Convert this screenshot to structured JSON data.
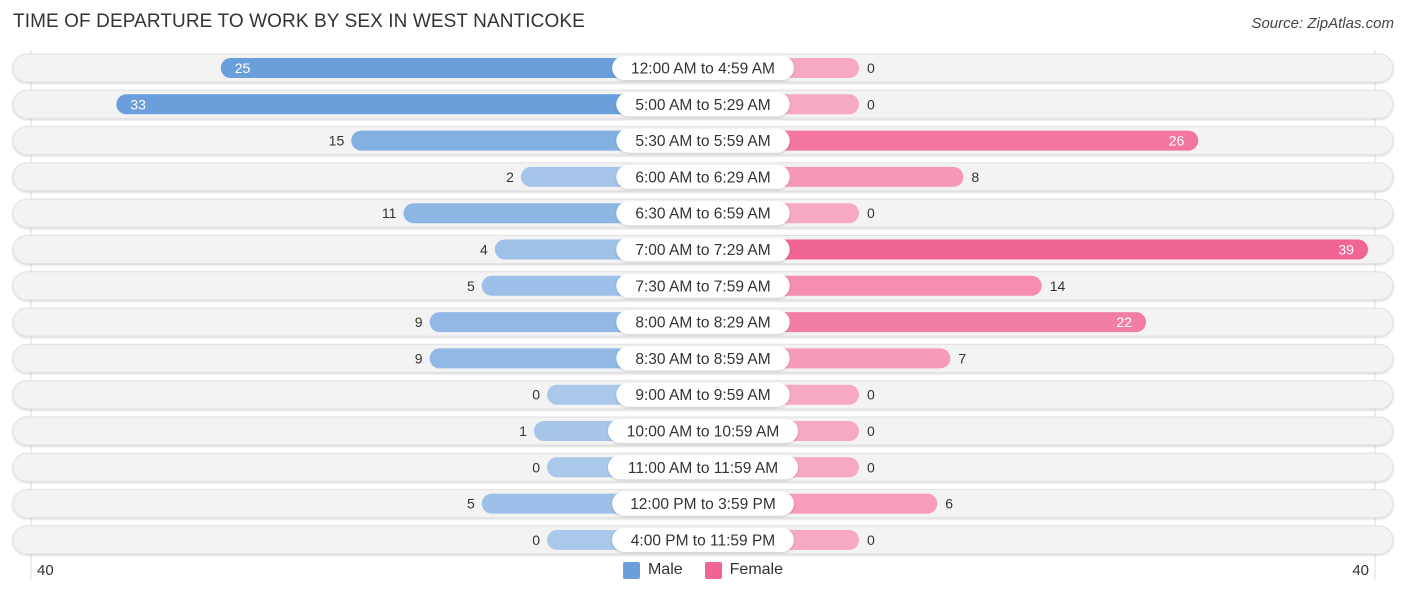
{
  "title": "TIME OF DEPARTURE TO WORK BY SEX IN WEST NANTICOKE",
  "source": "Source: ZipAtlas.com",
  "colors": {
    "male": "#6a9fdb",
    "male_light": "#a9c8ea",
    "female": "#f06592",
    "female_light": "#f7a8c2",
    "track": "#f3f3f3"
  },
  "chart_data": {
    "type": "bar",
    "orientation": "horizontal-diverging",
    "title": "TIME OF DEPARTURE TO WORK BY SEX IN WEST NANTICOKE",
    "categories": [
      "12:00 AM to 4:59 AM",
      "5:00 AM to 5:29 AM",
      "5:30 AM to 5:59 AM",
      "6:00 AM to 6:29 AM",
      "6:30 AM to 6:59 AM",
      "7:00 AM to 7:29 AM",
      "7:30 AM to 7:59 AM",
      "8:00 AM to 8:29 AM",
      "8:30 AM to 8:59 AM",
      "9:00 AM to 9:59 AM",
      "10:00 AM to 10:59 AM",
      "11:00 AM to 11:59 AM",
      "12:00 PM to 3:59 PM",
      "4:00 PM to 11:59 PM"
    ],
    "series": [
      {
        "name": "Male",
        "side": "left",
        "values": [
          25,
          33,
          15,
          2,
          11,
          4,
          5,
          9,
          9,
          0,
          1,
          0,
          5,
          0
        ]
      },
      {
        "name": "Female",
        "side": "right",
        "values": [
          0,
          0,
          26,
          8,
          0,
          39,
          14,
          22,
          7,
          0,
          0,
          0,
          6,
          0
        ]
      }
    ],
    "axis": {
      "min_label": "40",
      "max_label": "40",
      "range": [
        0,
        40
      ]
    },
    "legend": {
      "position": "bottom-center",
      "entries": [
        "Male",
        "Female"
      ]
    }
  }
}
